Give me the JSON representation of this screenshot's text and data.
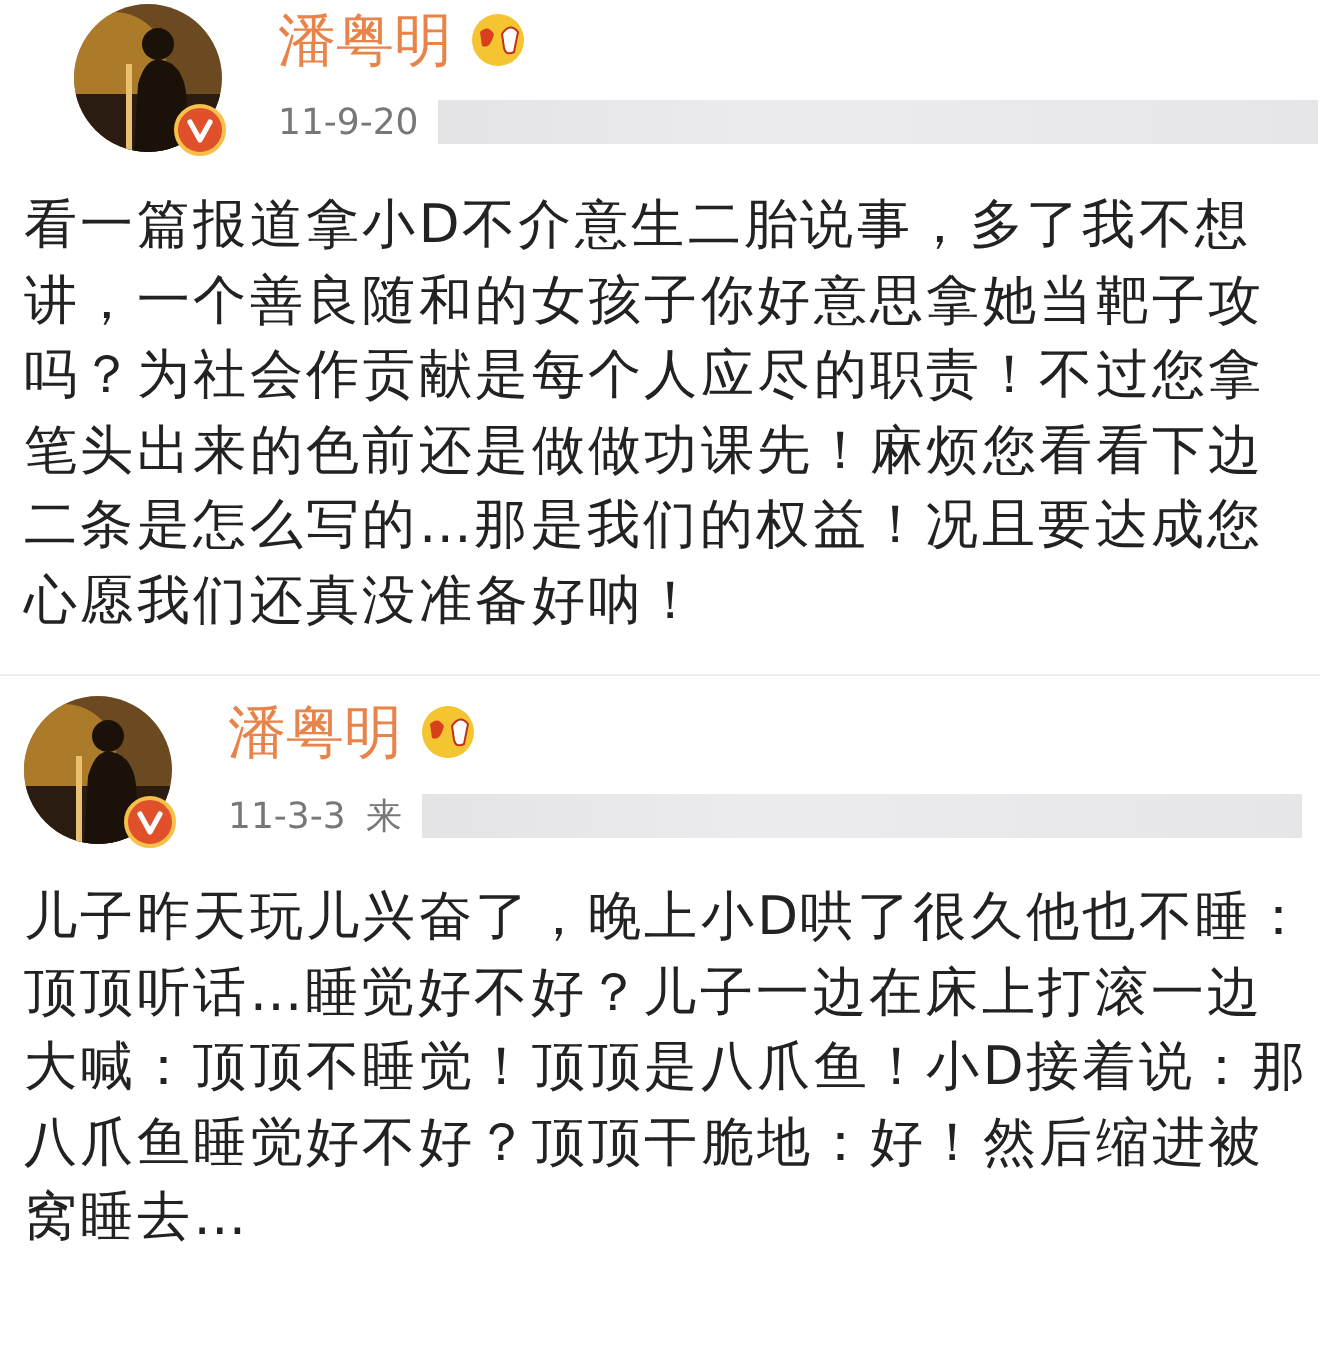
{
  "posts": [
    {
      "author": "潘粤明",
      "verified": true,
      "date": "11-9-20",
      "text": "看一篇报道拿小D不介意生二胎说事，多了我不想讲，一个善良随和的女孩子你好意思拿她当靶子攻吗？为社会作贡献是每个人应尽的职责！不过您拿笔头出来的色前还是做做功课先！麻烦您看看下边二条是怎么写的…那是我们的权益！况且要达成您心愿我们还真没准备好呐！"
    },
    {
      "author": "潘粤明",
      "verified": true,
      "date": "11-3-3",
      "source": "来",
      "text": "儿子昨天玩儿兴奋了，晚上小D哄了很久他也不睡：顶顶听话…睡觉好不好？儿子一边在床上打滚一边大喊：顶顶不睡觉！顶顶是八爪鱼！小D接着说：那八爪鱼睡觉好不好？顶顶干脆地：好！然后缩进被窝睡去…"
    }
  ]
}
